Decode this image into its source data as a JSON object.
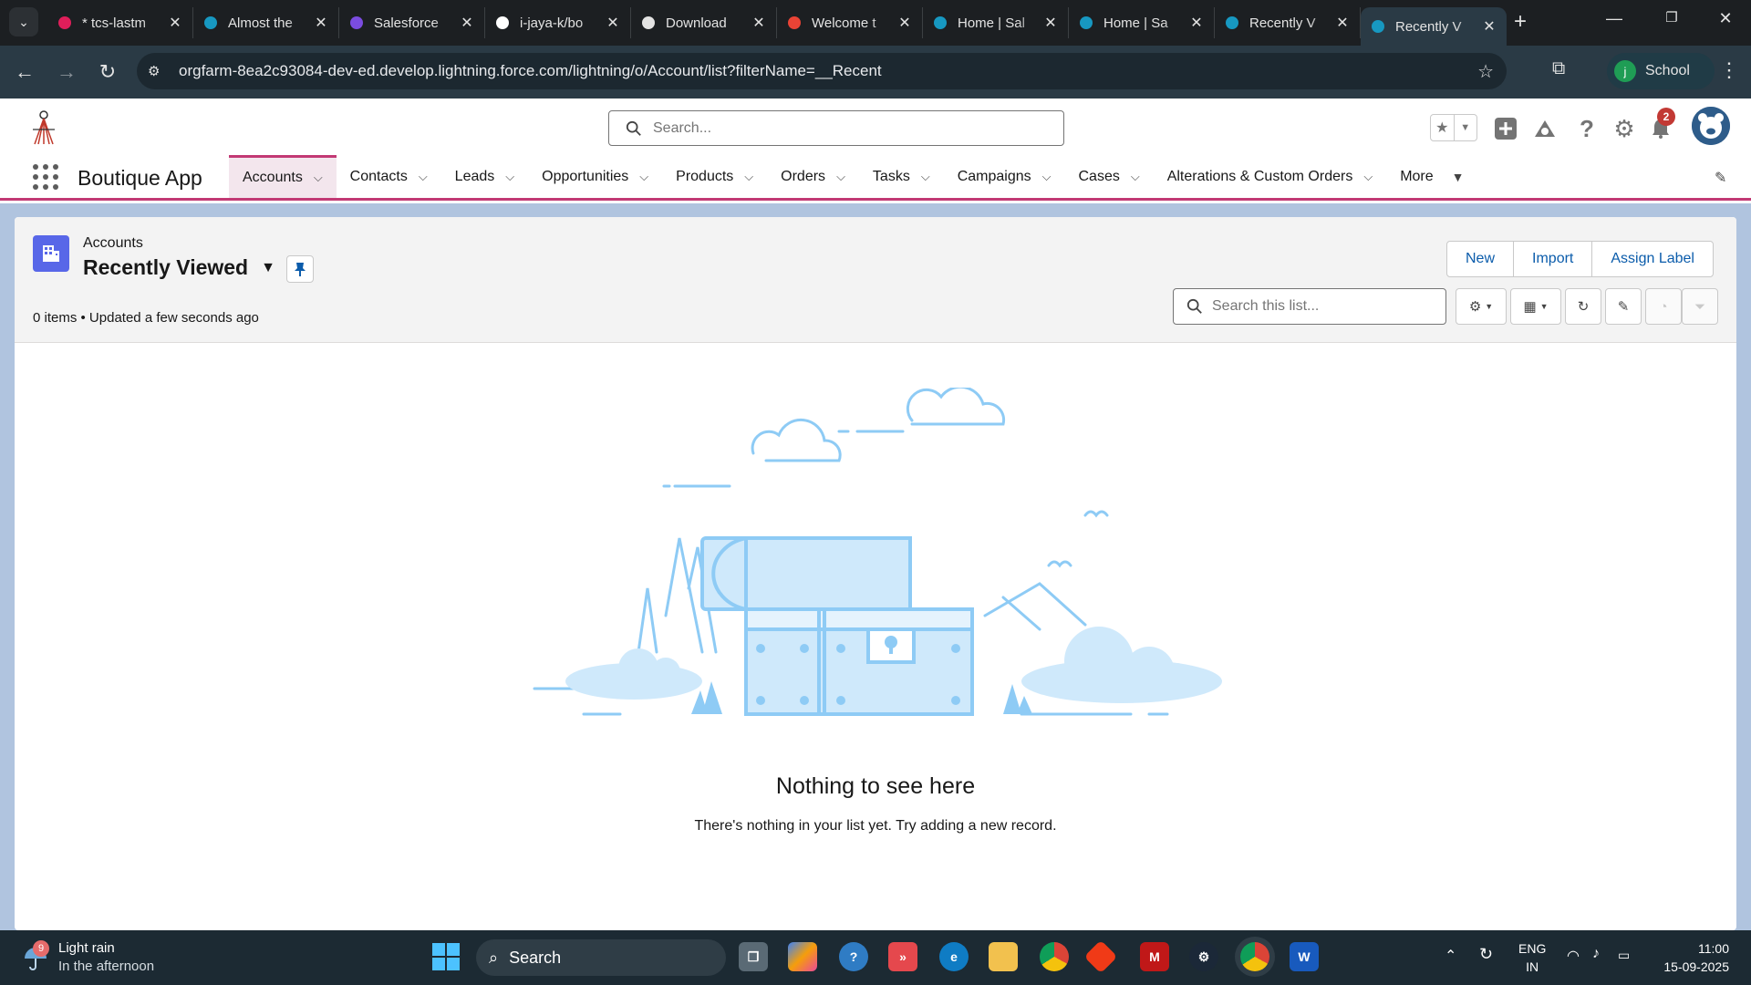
{
  "browser": {
    "tabs": [
      {
        "title": "* tcs-lastm",
        "icon": "slack-icon",
        "color": "#e01e5a"
      },
      {
        "title": "Almost the",
        "icon": "salesforce-cloud-icon",
        "color": "#1798c1"
      },
      {
        "title": "Salesforce",
        "icon": "form-icon",
        "color": "#7b4ce0"
      },
      {
        "title": "i-jaya-k/bo",
        "icon": "github-icon",
        "color": "#ffffff"
      },
      {
        "title": "Download",
        "icon": "download-icon",
        "color": "#e3e3e3"
      },
      {
        "title": "Welcome t",
        "icon": "gmail-icon",
        "color": "#ea4335"
      },
      {
        "title": "Home | Sal",
        "icon": "salesforce-cloud-icon",
        "color": "#1798c1"
      },
      {
        "title": "Home | Sa",
        "icon": "salesforce-cloud-icon",
        "color": "#1798c1"
      },
      {
        "title": "Recently V",
        "icon": "salesforce-cloud-icon",
        "color": "#1798c1"
      },
      {
        "title": "Recently V",
        "icon": "salesforce-cloud-icon",
        "color": "#1798c1",
        "active": true
      }
    ],
    "url": "orgfarm-8ea2c93084-dev-ed.develop.lightning.force.com/lightning/o/Account/list?filterName=__Recent",
    "profile_initial": "j",
    "profile_name": "School"
  },
  "sf_header": {
    "search_placeholder": "Search...",
    "notification_count": "2"
  },
  "sf_nav": {
    "app_name": "Boutique App",
    "items": [
      "Accounts",
      "Contacts",
      "Leads",
      "Opportunities",
      "Products",
      "Orders",
      "Tasks",
      "Campaigns",
      "Cases",
      "Alterations & Custom Orders",
      "More"
    ],
    "active": "Accounts"
  },
  "list_view": {
    "object_label": "Accounts",
    "view_name": "Recently Viewed",
    "meta": "0 items • Updated a few seconds ago",
    "buttons": [
      "New",
      "Import",
      "Assign Label"
    ],
    "search_placeholder": "Search this list..."
  },
  "empty_state": {
    "title": "Nothing to see here",
    "subtitle": "There's nothing in your list yet. Try adding a new record."
  },
  "taskbar": {
    "weather_badge": "9",
    "weather_line1": "Light rain",
    "weather_line2": "In the afternoon",
    "search_label": "Search",
    "lang_line1": "ENG",
    "lang_line2": "IN",
    "time": "11:00",
    "date": "15-09-2025"
  },
  "colors": {
    "accent": "#c23974",
    "link": "#0b5cab",
    "object_icon": "#5867e8",
    "illustration": "#8ecbf5"
  }
}
